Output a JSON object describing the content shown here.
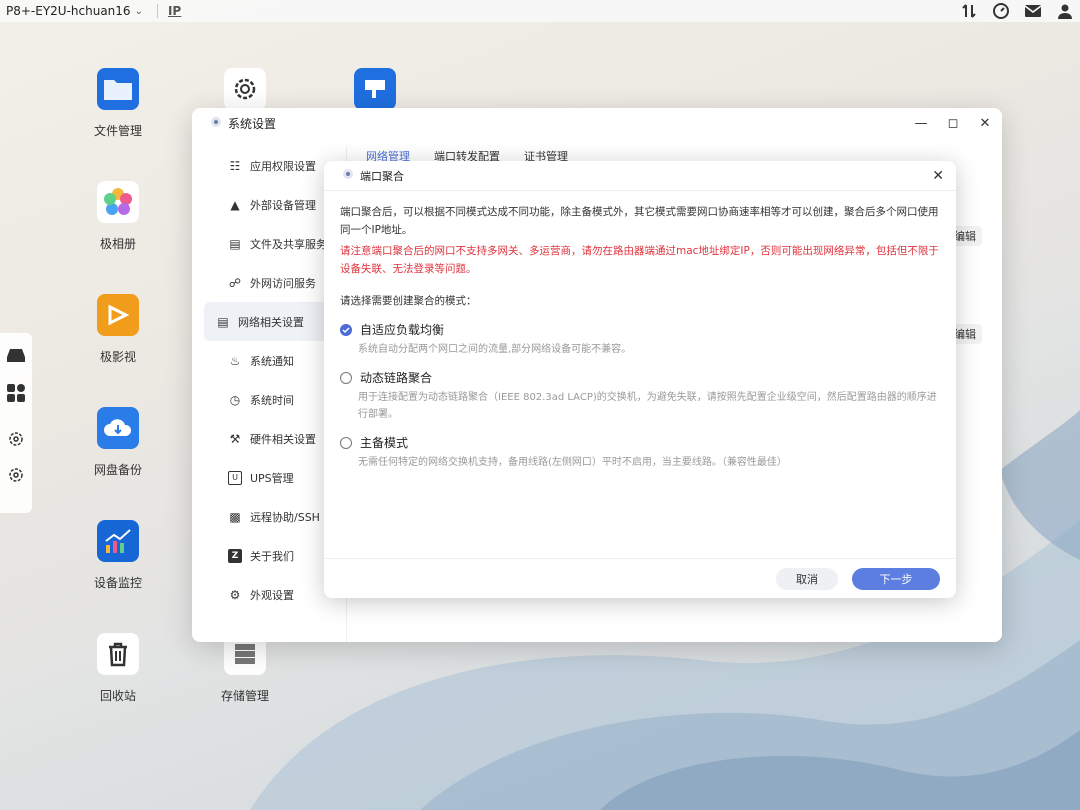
{
  "topbar": {
    "hostname": "P8+-EY2U-hchuan16",
    "ip_icon": "IP",
    "right_icons": [
      "transfer-icon",
      "speed-gauge-icon",
      "mail-icon",
      "user-icon"
    ]
  },
  "desktop": {
    "icons": [
      {
        "label": "文件管理",
        "icon": "folder-icon",
        "color": "#1f6fe0"
      },
      {
        "label": "极相册",
        "icon": "photos-flower-icon",
        "color": "#ffffff"
      },
      {
        "label": "极影视",
        "icon": "video-icon",
        "color": "#f29c1c"
      },
      {
        "label": "网盘备份",
        "icon": "cloud-backup-icon",
        "color": "#2a7ce8"
      },
      {
        "label": "设备监控",
        "icon": "monitor-chart-icon",
        "color": "#1766d6"
      },
      {
        "label": "回收站",
        "icon": "trash-icon",
        "color": "#ffffff"
      },
      {
        "label": "存储管理",
        "icon": "storage-icon",
        "color": "#ffffff"
      }
    ]
  },
  "window": {
    "title": "系统设置",
    "sidebar": [
      {
        "label": "应用权限设置",
        "icon": "sliders-icon"
      },
      {
        "label": "外部设备管理",
        "icon": "external-device-icon"
      },
      {
        "label": "文件及共享服务",
        "icon": "file-share-icon"
      },
      {
        "label": "外网访问服务",
        "icon": "link-icon"
      },
      {
        "label": "网络相关设置",
        "icon": "network-monitor-icon"
      },
      {
        "label": "系统通知",
        "icon": "bell-icon"
      },
      {
        "label": "系统时间",
        "icon": "clock-icon"
      },
      {
        "label": "硬件相关设置",
        "icon": "tools-icon"
      },
      {
        "label": "UPS管理",
        "icon": "ups-icon"
      },
      {
        "label": "远程协助/SSH",
        "icon": "remote-icon"
      },
      {
        "label": "关于我们",
        "icon": "about-icon"
      },
      {
        "label": "外观设置",
        "icon": "gear-icon"
      }
    ],
    "tabs": [
      "网络管理",
      "端口转发配置",
      "证书管理"
    ],
    "edit_label": "编辑"
  },
  "dialog": {
    "title": "端口聚合",
    "description": "端口聚合后，可以根据不同模式达成不同功能，除主备模式外，其它模式需要网口协商速率相等才可以创建，聚合后多个网口使用同一个IP地址。",
    "warning": "请注意端口聚合后的网口不支持多网关、多运营商，请勿在路由器端通过mac地址绑定IP，否则可能出现网络异常，包括但不限于设备失联、无法登录等问题。",
    "prompt": "请选择需要创建聚合的模式：",
    "options": [
      {
        "label": "自适应负载均衡",
        "desc": "系统自动分配两个网口之间的流量,部分网络设备可能不兼容。",
        "selected": true
      },
      {
        "label": "动态链路聚合",
        "desc": "用于连接配置为动态链路聚合（IEEE 802.3ad LACP)的交换机，为避免失联，请按照先配置企业级空间，然后配置路由器的顺序进行部署。",
        "selected": false
      },
      {
        "label": "主备模式",
        "desc": "无需任何特定的网络交换机支持，备用线路(左侧网口）平时不启用，当主要线路。（兼容性最佳）",
        "selected": false
      }
    ],
    "cancel_label": "取消",
    "next_label": "下一步"
  },
  "colors": {
    "accent": "#4a6cd4",
    "warning": "#e0333d",
    "primary_button": "#5b7ee0"
  }
}
